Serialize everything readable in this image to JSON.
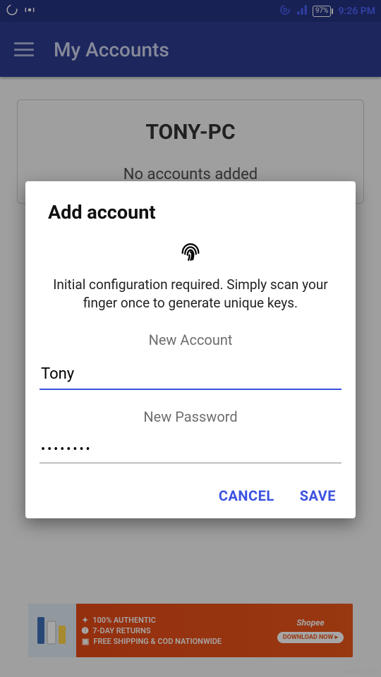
{
  "status_bar": {
    "battery_text": "97%",
    "clock": "9:26 PM"
  },
  "app_bar": {
    "title": "My Accounts"
  },
  "background_card": {
    "title": "TONY-PC",
    "subtitle": "No accounts added"
  },
  "dialog": {
    "title": "Add account",
    "message": "Initial configuration required. Simply scan your finger once to generate unique keys.",
    "account_label": "New Account",
    "account_value": "Tony",
    "password_label": "New Password",
    "password_value": "••••••••",
    "cancel": "CANCEL",
    "save": "SAVE"
  },
  "ad": {
    "line1": "100% AUTHENTIC",
    "line2": "7-DAY RETURNS",
    "line3": "FREE SHIPPING & COD NATIONWIDE",
    "brand": "Shopee",
    "cta": "DOWNLOAD NOW ▸"
  },
  "watermark": "wsxdn.com"
}
